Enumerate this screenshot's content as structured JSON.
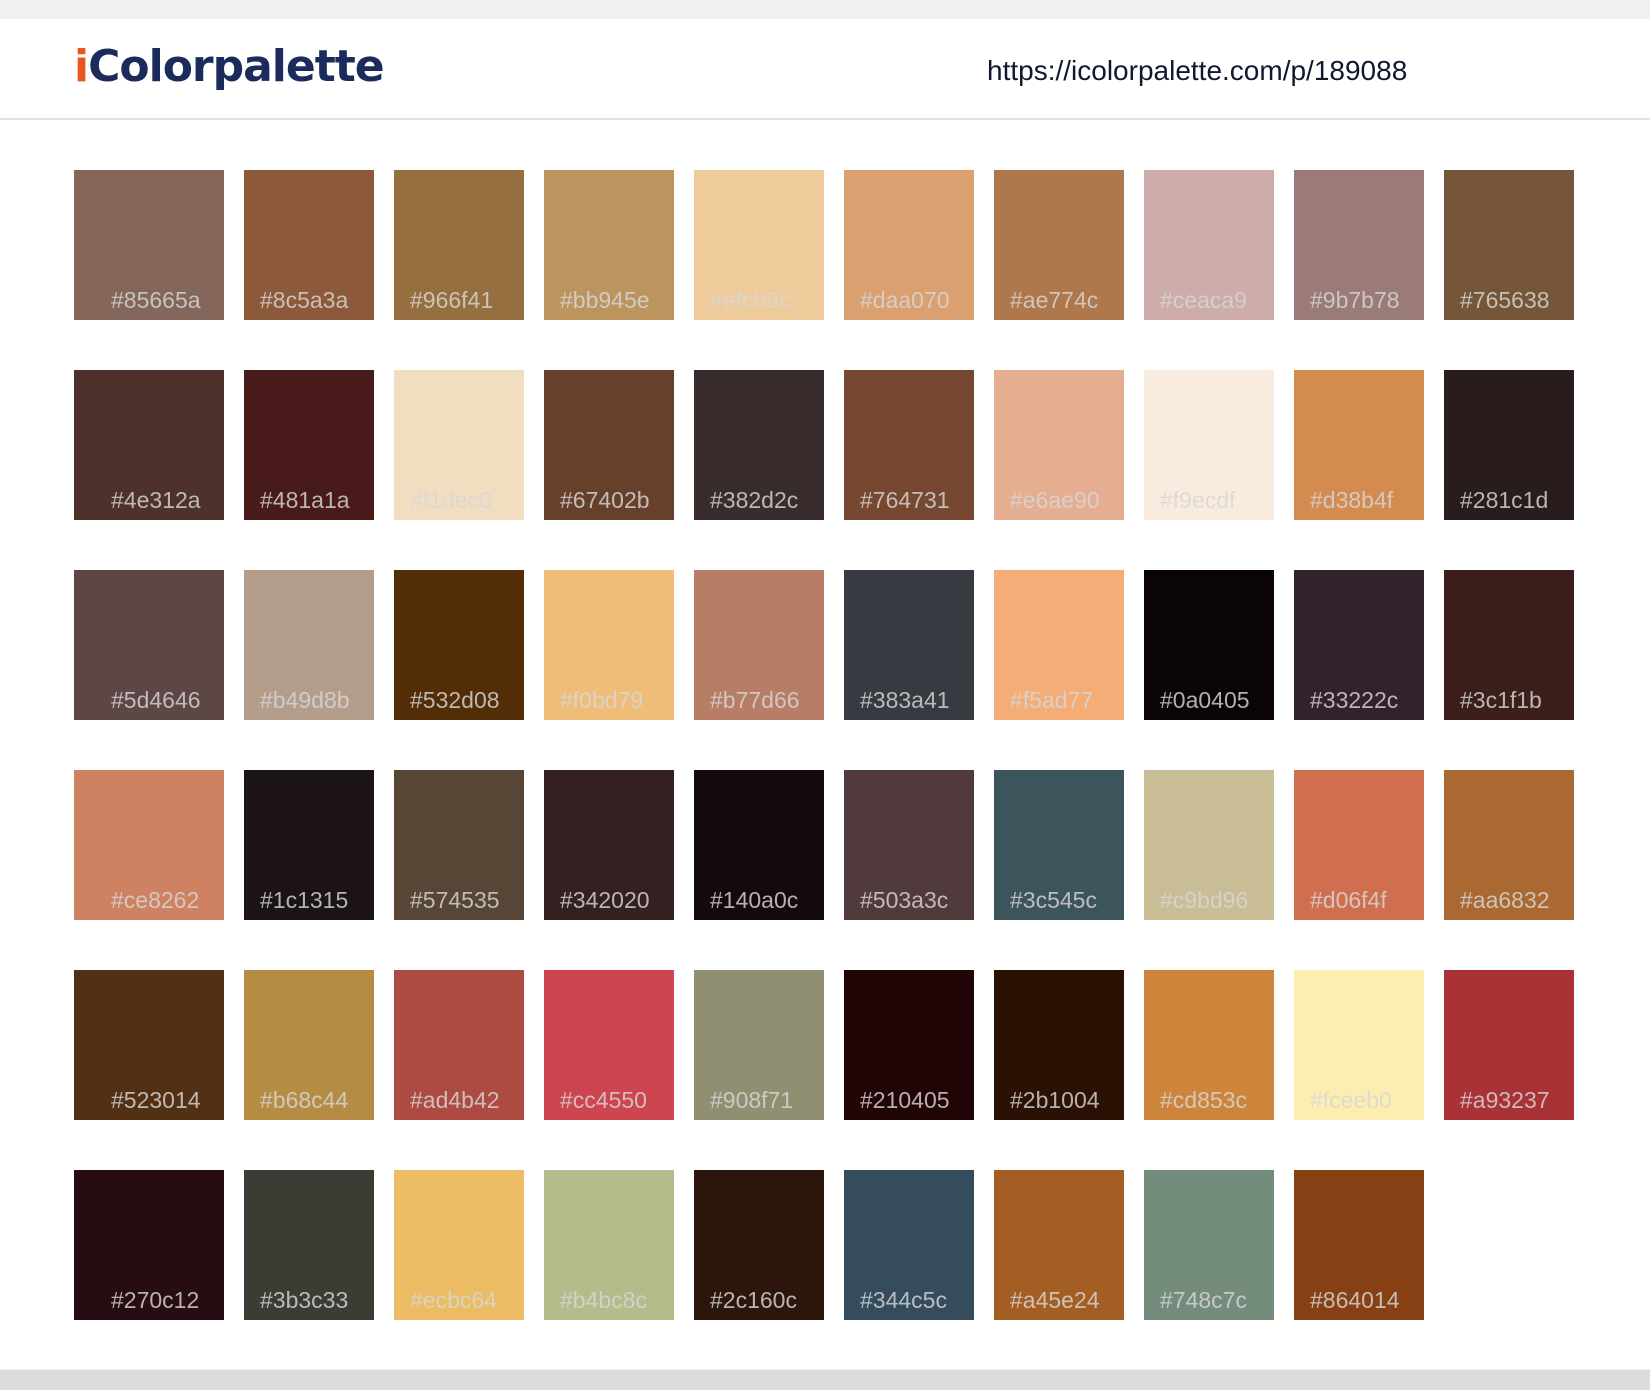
{
  "logo": {
    "first_letter": "i",
    "rest": "Colorpalette"
  },
  "url": "https://icolorpalette.com/p/189088",
  "swatches": [
    "#85665a",
    "#8c5a3a",
    "#966f41",
    "#bb945e",
    "#efcb9c",
    "#daa070",
    "#ae774c",
    "#ceaca9",
    "#9b7b78",
    "#765638",
    "#4e312a",
    "#481a1a",
    "#f1dec0",
    "#67402b",
    "#382d2c",
    "#764731",
    "#e6ae90",
    "#f9ecdf",
    "#d38b4f",
    "#281c1d",
    "#5d4646",
    "#b49d8b",
    "#532d08",
    "#f0bd79",
    "#b77d66",
    "#383a41",
    "#f5ad77",
    "#0a0405",
    "#33222c",
    "#3c1f1b",
    "#ce8262",
    "#1c1315",
    "#574535",
    "#342020",
    "#140a0c",
    "#503a3c",
    "#3c545c",
    "#c9bd96",
    "#d06f4f",
    "#aa6832",
    "#523014",
    "#b68c44",
    "#ad4b42",
    "#cc4550",
    "#908f71",
    "#210405",
    "#2b1004",
    "#cd853c",
    "#fceeb0",
    "#a93237",
    "#270c12",
    "#3b3c33",
    "#ecbc64",
    "#b4bc8c",
    "#2c160c",
    "#344c5c",
    "#a45e24",
    "#748c7c",
    "#864014"
  ]
}
